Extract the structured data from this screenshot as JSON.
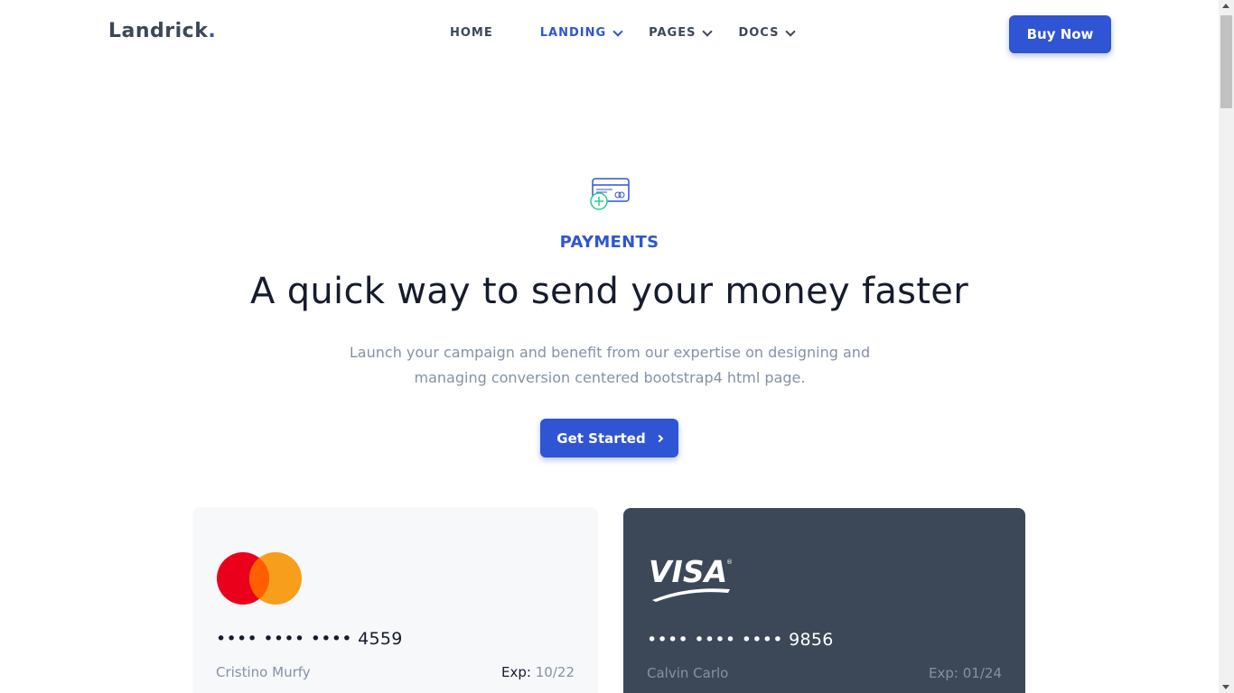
{
  "nav": {
    "logo_text": "Landrick",
    "logo_dot": ".",
    "items": [
      {
        "label": "HOME"
      },
      {
        "label": "LANDING"
      },
      {
        "label": "PAGES"
      },
      {
        "label": "DOCS"
      }
    ],
    "buy_label": "Buy Now"
  },
  "hero": {
    "icon": "credit-card-add-icon",
    "eyebrow": "PAYMENTS",
    "headline": "A quick way to send your money faster",
    "subtext": "Launch your campaign and benefit from our expertise on designing and managing conversion centered bootstrap4 html page.",
    "cta_label": "Get Started"
  },
  "cards": [
    {
      "brand": "mastercard-logo",
      "number": "•••• •••• •••• 4559",
      "holder": "Cristino Murfy",
      "exp_label": "Exp:",
      "exp_value": "10/22"
    },
    {
      "brand": "visa-logo",
      "visa_text": "VISA",
      "number": "•••• •••• •••• 9856",
      "holder": "Calvin Carlo",
      "exp_label": "Exp:",
      "exp_value": "01/24"
    }
  ],
  "colors": {
    "primary": "#2f55d4",
    "dark_card": "#3c4858",
    "light_card": "#f7f8fa",
    "muted": "#8492a6",
    "mc_red": "#eb001b",
    "mc_orange": "#f79e1b"
  }
}
